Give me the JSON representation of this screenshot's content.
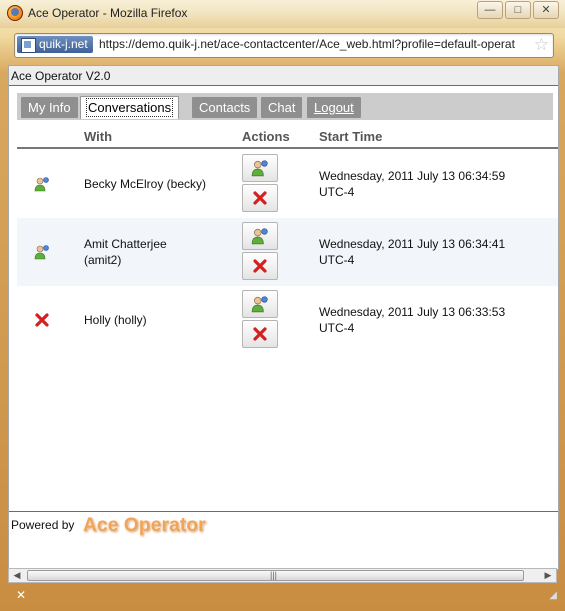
{
  "window": {
    "title": "Ace Operator - Mozilla Firefox",
    "site_identity": "quik-j.net",
    "url": "https://demo.quik-j.net/ace-contactcenter/Ace_web.html?profile=default-operat",
    "minimize_glyph": "—",
    "maximize_glyph": "□",
    "close_glyph": "✕"
  },
  "app": {
    "header_title": "Ace Operator V2.0",
    "tabs": [
      {
        "label": "My Info",
        "active": false
      },
      {
        "label": "Conversations",
        "active": true
      },
      {
        "label": "Contacts",
        "active": false
      },
      {
        "label": "Chat",
        "active": false
      },
      {
        "label": "Logout",
        "active": false
      }
    ],
    "columns": {
      "with": "With",
      "actions": "Actions",
      "start_time": "Start Time"
    },
    "conversations": [
      {
        "status_icon": "user-online-icon",
        "name_line1": "Becky McElroy (becky)",
        "name_line2": "",
        "time_line1": "Wednesday, 2011 July 13 06:34:59",
        "time_line2": "UTC-4"
      },
      {
        "status_icon": "user-online-icon",
        "name_line1": "Amit Chatterjee",
        "name_line2": "(amit2)",
        "time_line1": "Wednesday, 2011 July 13 06:34:41",
        "time_line2": "UTC-4"
      },
      {
        "status_icon": "disconnected-x-icon",
        "name_line1": "Holly (holly)",
        "name_line2": "",
        "time_line1": "Wednesday, 2011 July 13 06:33:53",
        "time_line2": "UTC-4"
      }
    ],
    "footer": {
      "powered_by": "Powered by",
      "logo_text": "Ace Operator"
    }
  },
  "scrollbar": {
    "left_arrow": "◀",
    "right_arrow": "▶",
    "grip": "|||"
  },
  "colors": {
    "accent_red": "#c04848",
    "tab_gray": "#8f8f8f",
    "logo_orange": "#f0a457"
  }
}
